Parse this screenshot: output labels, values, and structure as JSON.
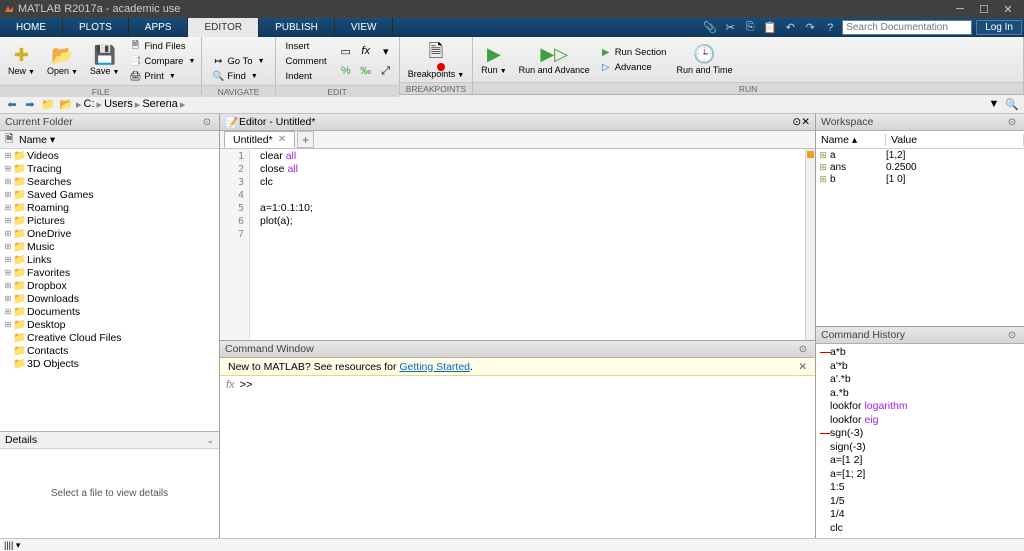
{
  "titlebar": {
    "title": "MATLAB R2017a - academic use"
  },
  "maintabs": {
    "home": "HOME",
    "plots": "PLOTS",
    "apps": "APPS",
    "editor": "EDITOR",
    "publish": "PUBLISH",
    "view": "VIEW",
    "searchPlaceholder": "Search Documentation",
    "login": "Log In"
  },
  "toolstrip": {
    "file": {
      "new": "New",
      "open": "Open",
      "save": "Save",
      "findfiles": "Find Files",
      "compare": "Compare",
      "print": "Print",
      "label": "FILE"
    },
    "navigate": {
      "goto": "Go To",
      "find": "Find",
      "label": "NAVIGATE"
    },
    "edit": {
      "insert": "Insert",
      "comment": "Comment",
      "indent": "Indent",
      "label": "EDIT"
    },
    "breakpoints": {
      "breakpoints": "Breakpoints",
      "label": "BREAKPOINTS"
    },
    "run": {
      "run": "Run",
      "runadvance": "Run and\nAdvance",
      "runsection": "Run Section",
      "advance": "Advance",
      "runtime": "Run and\nTime",
      "label": "RUN"
    }
  },
  "address": {
    "crumbs": [
      "C:",
      "Users",
      "Serena"
    ]
  },
  "currentFolder": {
    "title": "Current Folder",
    "nameCol": "Name",
    "items": [
      {
        "name": "Videos",
        "exp": true
      },
      {
        "name": "Tracing",
        "exp": true
      },
      {
        "name": "Searches",
        "exp": true
      },
      {
        "name": "Saved Games",
        "exp": true
      },
      {
        "name": "Roaming",
        "exp": true
      },
      {
        "name": "Pictures",
        "exp": true
      },
      {
        "name": "OneDrive",
        "exp": true
      },
      {
        "name": "Music",
        "exp": true
      },
      {
        "name": "Links",
        "exp": true
      },
      {
        "name": "Favorites",
        "exp": true
      },
      {
        "name": "Dropbox",
        "exp": true
      },
      {
        "name": "Downloads",
        "exp": true
      },
      {
        "name": "Documents",
        "exp": true
      },
      {
        "name": "Desktop",
        "exp": true
      },
      {
        "name": "Creative Cloud Files",
        "exp": false
      },
      {
        "name": "Contacts",
        "exp": false
      },
      {
        "name": "3D Objects",
        "exp": false
      }
    ]
  },
  "details": {
    "title": "Details",
    "body": "Select a file to view details"
  },
  "editor": {
    "title": "Editor - Untitled*",
    "tab": "Untitled*",
    "codeLines": [
      {
        "parts": [
          {
            "t": "clear "
          },
          {
            "t": "all",
            "kw": true
          }
        ]
      },
      {
        "parts": [
          {
            "t": "close "
          },
          {
            "t": "all",
            "kw": true
          }
        ]
      },
      {
        "parts": [
          {
            "t": "clc"
          }
        ]
      },
      {
        "parts": []
      },
      {
        "parts": [
          {
            "t": "a=1:0.1:10;"
          }
        ]
      },
      {
        "parts": [
          {
            "t": "plot(a);"
          }
        ]
      },
      {
        "parts": []
      }
    ]
  },
  "commandWindow": {
    "title": "Command Window",
    "bannerPre": "New to MATLAB? See resources for ",
    "bannerLink": "Getting Started",
    "bannerPost": ".",
    "promptPrefix": "fx",
    "prompt": ">>"
  },
  "workspace": {
    "title": "Workspace",
    "nameCol": "Name",
    "valueCol": "Value",
    "vars": [
      {
        "name": "a",
        "value": "[1,2]"
      },
      {
        "name": "ans",
        "value": "0.2500"
      },
      {
        "name": "b",
        "value": "[1 0]"
      }
    ]
  },
  "commandHistory": {
    "title": "Command History",
    "lines": [
      {
        "cmd": "a*b",
        "err": true
      },
      {
        "cmd": "a'*b"
      },
      {
        "cmd": "a'.*b"
      },
      {
        "cmd": "a.*b"
      },
      {
        "cmd": "lookfor ",
        "col": "logarithm"
      },
      {
        "cmd": "lookfor ",
        "col": "eig"
      },
      {
        "cmd": "sgn(-3)",
        "err": true
      },
      {
        "cmd": "sign(-3)"
      },
      {
        "cmd": "a=[1 2]"
      },
      {
        "cmd": "a=[1; 2]"
      },
      {
        "cmd": "1:5"
      },
      {
        "cmd": "1/5"
      },
      {
        "cmd": "1/4"
      },
      {
        "cmd": "clc"
      }
    ]
  },
  "status": {
    "text": "|||| ▾"
  }
}
